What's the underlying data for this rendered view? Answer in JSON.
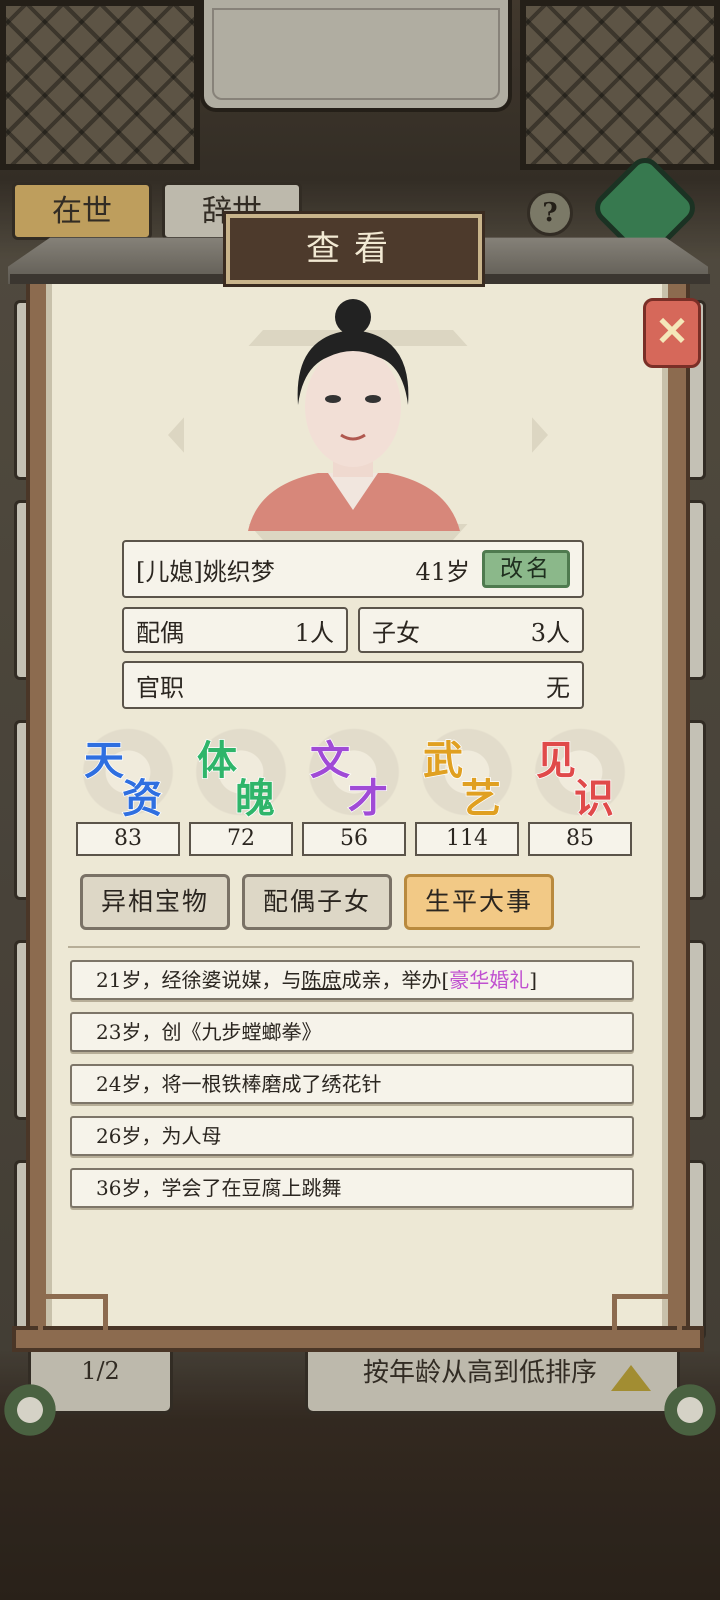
{
  "background": {
    "tab_alive": "在世",
    "tab_deceased": "辞世",
    "help_symbol": "?",
    "pager": "1/2",
    "sort_label": "按年龄从高到低排序"
  },
  "modal": {
    "title": "查看",
    "close_icon": "close-x-icon",
    "person": {
      "name": "[儿媳]姚织梦",
      "age": "41岁",
      "rename_label": "改名"
    },
    "spouse": {
      "label": "配偶",
      "value": "1人"
    },
    "children": {
      "label": "子女",
      "value": "3人"
    },
    "office": {
      "label": "官职",
      "value": "无"
    },
    "stats": [
      {
        "c1": "天",
        "c2": "资",
        "value": "83",
        "color": "#2f6fe0"
      },
      {
        "c1": "体",
        "c2": "魄",
        "value": "72",
        "color": "#2fb56a"
      },
      {
        "c1": "文",
        "c2": "才",
        "value": "56",
        "color": "#a04bd6"
      },
      {
        "c1": "武",
        "c2": "艺",
        "value": "114",
        "color": "#e0a021"
      },
      {
        "c1": "见",
        "c2": "识",
        "value": "85",
        "color": "#e04a4a"
      }
    ],
    "tabs": [
      "异相宝物",
      "配偶子女",
      "生平大事"
    ],
    "active_tab": "生平大事",
    "events": [
      {
        "pre": "21岁，经徐婆说媒，与",
        "link": "陈庶",
        "mid": "成亲，举办[",
        "highlight": "豪华婚礼",
        "post": "]"
      },
      {
        "text": "23岁，创《九步螳螂拳》"
      },
      {
        "text": "24岁，将一根铁棒磨成了绣花针"
      },
      {
        "text": "26岁，为人母"
      },
      {
        "text": "36岁，学会了在豆腐上跳舞"
      }
    ]
  }
}
